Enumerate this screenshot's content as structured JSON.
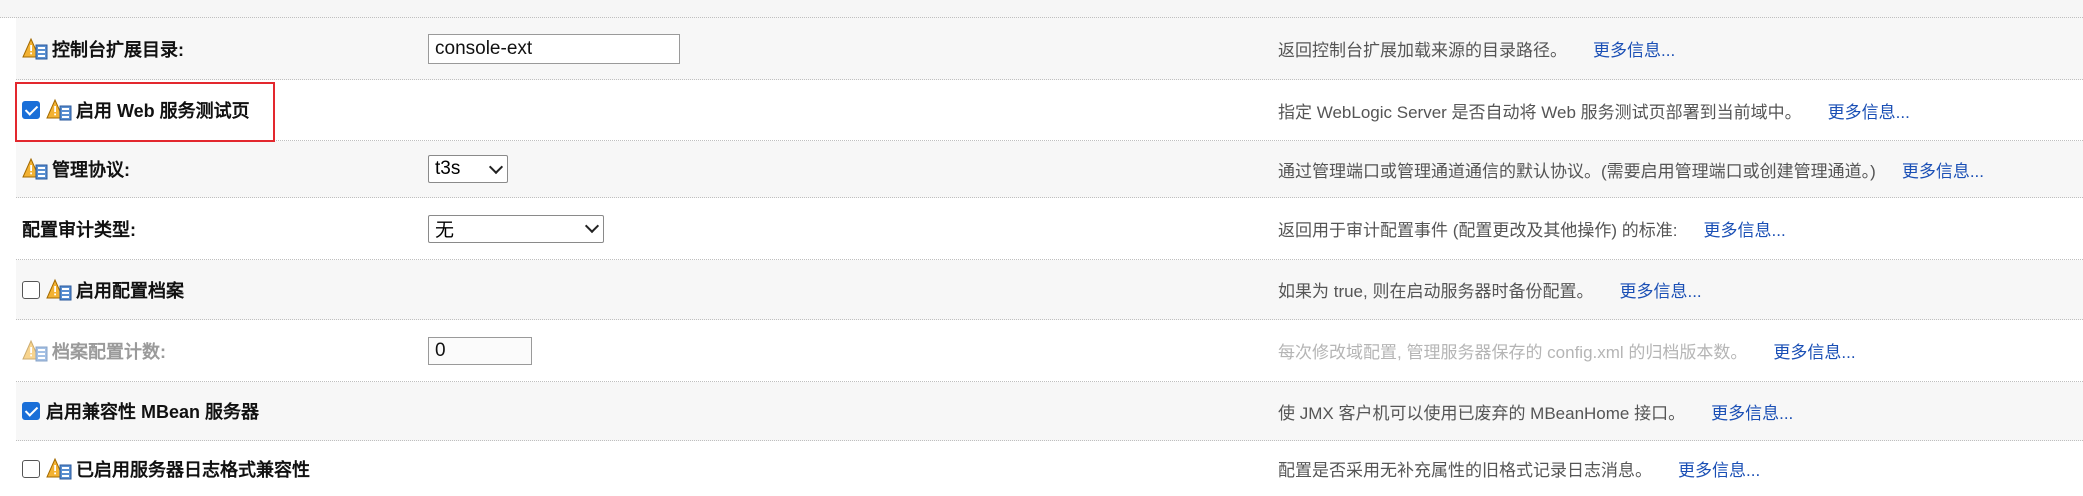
{
  "rows": [
    {
      "label": "控制台扩展目录:",
      "input_value": "console-ext",
      "description": "返回控制台扩展加载来源的目录路径。",
      "more": "更多信息..."
    },
    {
      "label": "启用 Web 服务测试页",
      "checked": true,
      "description": "指定 WebLogic Server 是否自动将 Web 服务测试页部署到当前域中。",
      "more": "更多信息..."
    },
    {
      "label": "管理协议:",
      "select_value": "t3s",
      "description": "通过管理端口或管理通道通信的默认协议。(需要启用管理端口或创建管理通道。)",
      "more": "更多信息..."
    },
    {
      "label": "配置审计类型:",
      "select_value": "无",
      "description": "返回用于审计配置事件 (配置更改及其他操作) 的标准:",
      "more": "更多信息..."
    },
    {
      "label": "启用配置档案",
      "checked": false,
      "description": "如果为 true, 则在启动服务器时备份配置。",
      "more": "更多信息..."
    },
    {
      "label": "档案配置计数:",
      "input_value": "0",
      "description": "每次修改域配置, 管理服务器保存的 config.xml 的归档版本数。",
      "more": "更多信息..."
    },
    {
      "label": "启用兼容性 MBean 服务器",
      "checked": true,
      "description": "使 JMX 客户机可以使用已废弃的 MBeanHome 接口。",
      "more": "更多信息..."
    },
    {
      "label": "已启用服务器日志格式兼容性",
      "checked": false,
      "description": "配置是否采用无补充属性的旧格式记录日志消息。",
      "more": "更多信息..."
    }
  ],
  "colors": {
    "link": "#1a4fb5",
    "highlight": "#e3282e",
    "checkbox": "#1a6fd8"
  },
  "icons": {
    "warning": "restart-required-icon"
  }
}
